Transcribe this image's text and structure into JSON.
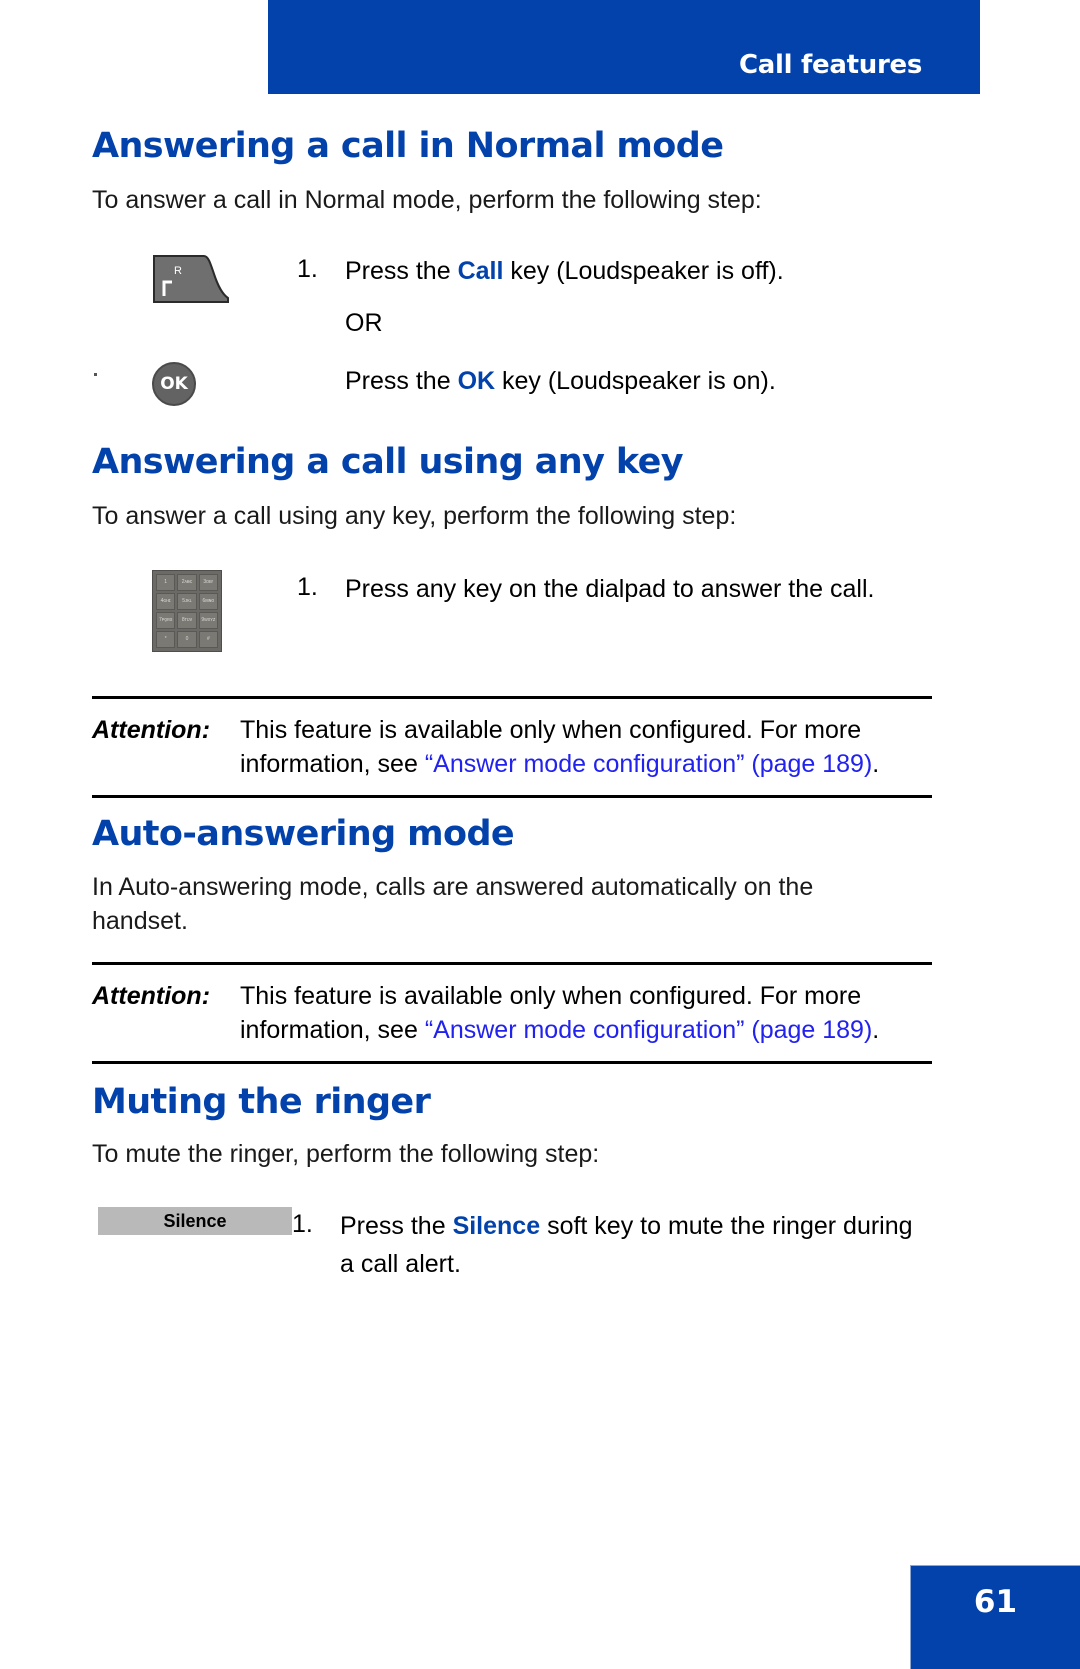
{
  "header": {
    "title": "Call features"
  },
  "sections": [
    {
      "heading": "Answering a call in Normal mode",
      "intro": "To answer a call in Normal mode, perform the following step:",
      "steps": [
        {
          "number": "1.",
          "icon": "call-key-icon",
          "icon_label": "R",
          "text_before": "Press the ",
          "keyword": "Call",
          "text_after": " key (Loudspeaker is off)."
        },
        {
          "number": "",
          "or_label": "OR"
        },
        {
          "number": "",
          "icon": "ok-key-icon",
          "icon_label": "OK",
          "text_before": "Press the ",
          "keyword": "OK",
          "text_after": " key (Loudspeaker is on)."
        }
      ]
    },
    {
      "heading": "Answering a call using any key",
      "intro": "To answer a call using any key, perform the following step:",
      "steps": [
        {
          "number": "1.",
          "icon": "dialpad-icon",
          "text_plain": "Press any key on the dialpad to answer the call."
        }
      ]
    },
    {
      "heading": "Auto-answering mode",
      "intro": "In Auto-answering mode, calls are answered automatically on the handset."
    },
    {
      "heading": "Muting the ringer",
      "intro": "To mute the ringer, perform the following step:",
      "steps": [
        {
          "number": "1.",
          "icon": "silence-softkey",
          "icon_label": "Silence",
          "text_before": "Press the ",
          "keyword": "Silence",
          "text_after": " soft key to mute the ringer during a call alert."
        }
      ]
    }
  ],
  "attention_blocks": [
    {
      "label": "Attention:",
      "line1": "This feature is available only when configured. For more",
      "line2_before": "information, see ",
      "line2_link": "“Answer mode configuration” (page 189)",
      "line2_after": "."
    },
    {
      "label": "Attention:",
      "line1": "This feature is available only when configured. For more",
      "line2_before": "information, see ",
      "line2_link": "“Answer mode configuration” (page 189)",
      "line2_after": "."
    }
  ],
  "dialpad_keys": [
    "1",
    "2ᴀᴃᴄ",
    "3ᴅᴇғ",
    "4ɢʜɪ",
    "5ᴊᴋʟ",
    "6ᴍɴᴏ",
    "7ᴘǫʀs",
    "8ᴛᴜᴠ",
    "9ᴡxʏᴢ",
    "*",
    "0",
    "#"
  ],
  "footer": {
    "page_number": "61"
  },
  "colors": {
    "brand_blue": "#0342AA",
    "link_blue": "#2222EE",
    "softkey_gray": "#b9b9b9"
  }
}
